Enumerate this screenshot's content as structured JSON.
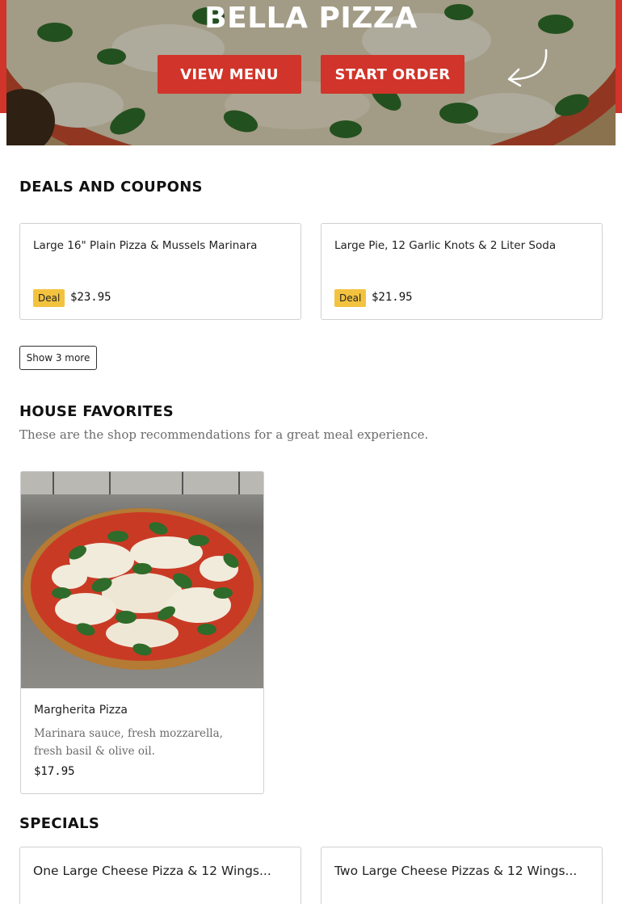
{
  "hero": {
    "title": "BELLA PIZZA",
    "view_menu_label": "VIEW MENU",
    "start_order_label": "START ORDER",
    "accent_color": "#d1342a"
  },
  "deals": {
    "title": "DEALS AND COUPONS",
    "items": [
      {
        "name": "Large 16\" Plain Pizza & Mussels Marinara",
        "badge": "Deal",
        "price": "$23.95"
      },
      {
        "name": "Large Pie, 12 Garlic Knots & 2 Liter Soda",
        "badge": "Deal",
        "price": "$21.95"
      }
    ],
    "show_more_label": "Show 3 more",
    "badge_color": "#f3c33f"
  },
  "favorites": {
    "title": "HOUSE FAVORITES",
    "subtitle": "These are the shop recommendations for a great meal experience.",
    "items": [
      {
        "name": "Margherita Pizza",
        "description": "Marinara sauce, fresh mozzarella, fresh basil & olive oil.",
        "price": "$17.95"
      }
    ]
  },
  "specials": {
    "title": "SPECIALS",
    "items": [
      {
        "name": "One Large Cheese Pizza & 12 Wings..."
      },
      {
        "name": "Two Large Cheese Pizzas & 12 Wings..."
      }
    ]
  }
}
